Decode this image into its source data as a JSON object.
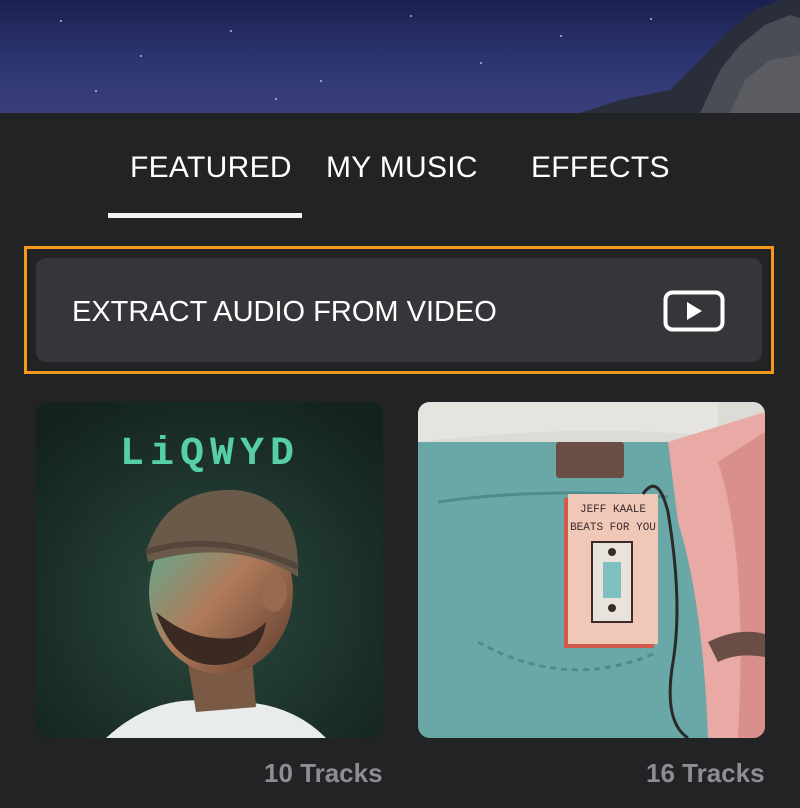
{
  "tabs": [
    {
      "label": "FEATURED",
      "active": true
    },
    {
      "label": "MY MUSIC",
      "active": false
    },
    {
      "label": "EFFECTS",
      "active": false
    }
  ],
  "extract": {
    "label": "EXTRACT AUDIO FROM VIDEO",
    "icon": "play-video-icon"
  },
  "albums": [
    {
      "art_text": "LiQWYD",
      "tracks": "10 Tracks"
    },
    {
      "art_text_1": "JEFF KAALE",
      "art_text_2": "BEATS FOR YOU",
      "tracks": "16 Tracks"
    }
  ],
  "colors": {
    "background": "#222325",
    "accent_border": "#f39a1e",
    "panel": "#35363a",
    "muted_text": "#8d8e92"
  }
}
